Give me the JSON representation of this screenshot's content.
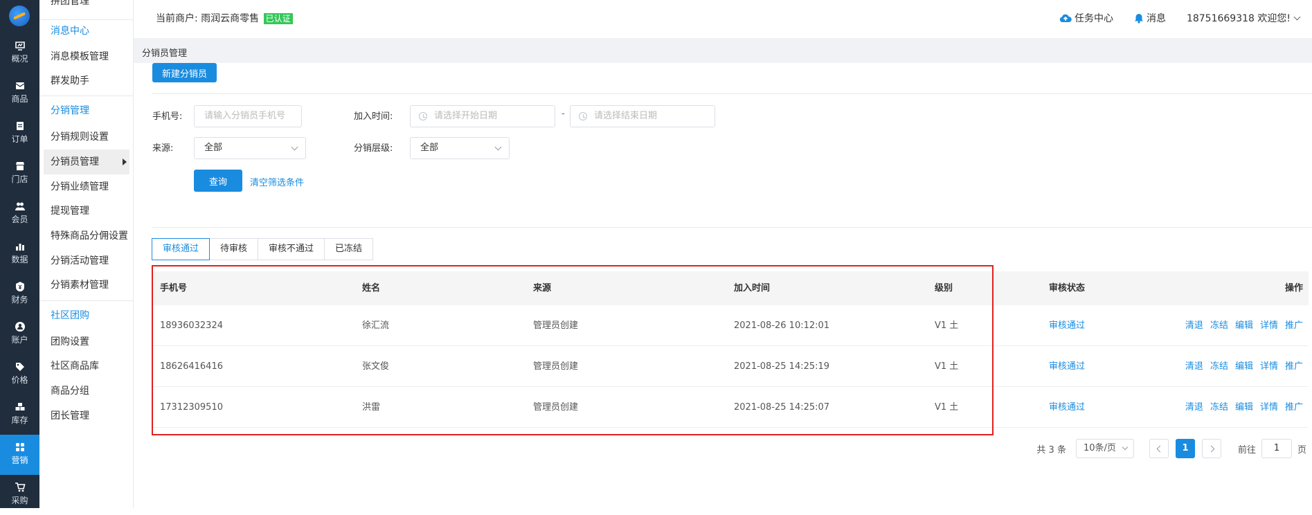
{
  "rail": {
    "items": [
      {
        "label": "概况",
        "icon": "dashboard-icon"
      },
      {
        "label": "商品",
        "icon": "goods-icon"
      },
      {
        "label": "订单",
        "icon": "order-icon"
      },
      {
        "label": "门店",
        "icon": "store-icon"
      },
      {
        "label": "会员",
        "icon": "member-icon"
      },
      {
        "label": "数据",
        "icon": "data-icon"
      },
      {
        "label": "财务",
        "icon": "finance-icon"
      },
      {
        "label": "账户",
        "icon": "account-icon"
      },
      {
        "label": "价格",
        "icon": "price-icon"
      },
      {
        "label": "库存",
        "icon": "stock-icon"
      },
      {
        "label": "营销",
        "icon": "marketing-icon"
      },
      {
        "label": "采购",
        "icon": "purchase-icon"
      }
    ],
    "active_color": "#1a8ce0"
  },
  "submenu": {
    "items": [
      {
        "label": "拼团管理",
        "type": "item"
      },
      {
        "label": "消息中心",
        "type": "group"
      },
      {
        "label": "消息模板管理",
        "type": "item"
      },
      {
        "label": "群发助手",
        "type": "item"
      },
      {
        "label": "分销管理",
        "type": "group"
      },
      {
        "label": "分销规则设置",
        "type": "item"
      },
      {
        "label": "分销员管理",
        "type": "item"
      },
      {
        "label": "分销业绩管理",
        "type": "item"
      },
      {
        "label": "提现管理",
        "type": "item"
      },
      {
        "label": "特殊商品分佣设置",
        "type": "item"
      },
      {
        "label": "分销活动管理",
        "type": "item"
      },
      {
        "label": "分销素材管理",
        "type": "item"
      },
      {
        "label": "社区团购",
        "type": "group"
      },
      {
        "label": "团购设置",
        "type": "item"
      },
      {
        "label": "社区商品库",
        "type": "item"
      },
      {
        "label": "商品分组",
        "type": "item"
      },
      {
        "label": "团长管理",
        "type": "item"
      }
    ]
  },
  "header": {
    "merchant_label": "当前商户: 雨润云商零售",
    "verified": "已认证",
    "task_center": "任务中心",
    "messages": "消息",
    "user": "18751669318 欢迎您!"
  },
  "breadcrumb": "分销员管理",
  "toolbar": {
    "new_button": "新建分销员"
  },
  "filters": {
    "phone_label": "手机号:",
    "phone_placeholder": "请输入分销员手机号",
    "join_time_label": "加入时间:",
    "start_placeholder": "请选择开始日期",
    "date_separator": "-",
    "end_placeholder": "请选择结束日期",
    "source_label": "来源:",
    "source_value": "全部",
    "level_label": "分销层级:",
    "level_value": "全部",
    "query_button": "查询",
    "clear_link": "清空筛选条件"
  },
  "tabs": [
    "审核通过",
    "待审核",
    "审核不通过",
    "已冻结"
  ],
  "table": {
    "columns": [
      "手机号",
      "姓名",
      "来源",
      "加入时间",
      "级别",
      "审核状态",
      "操作"
    ],
    "rows": [
      {
        "phone": "18936032324",
        "name": "徐汇流",
        "source": "管理员创建",
        "time": "2021-08-26 10:12:01",
        "level": "V1 土",
        "status": "审核通过"
      },
      {
        "phone": "18626416416",
        "name": "张文俊",
        "source": "管理员创建",
        "time": "2021-08-25 14:25:19",
        "level": "V1 土",
        "status": "审核通过"
      },
      {
        "phone": "17312309510",
        "name": "洪雷",
        "source": "管理员创建",
        "time": "2021-08-25 14:25:07",
        "level": "V1 土",
        "status": "审核通过"
      }
    ],
    "actions": [
      "清退",
      "冻结",
      "编辑",
      "详情",
      "推广"
    ]
  },
  "pagination": {
    "total": "共 3 条",
    "page_size": "10条/页",
    "current_page": "1",
    "goto_label": "前往",
    "goto_value": "1",
    "page_suffix": "页"
  }
}
